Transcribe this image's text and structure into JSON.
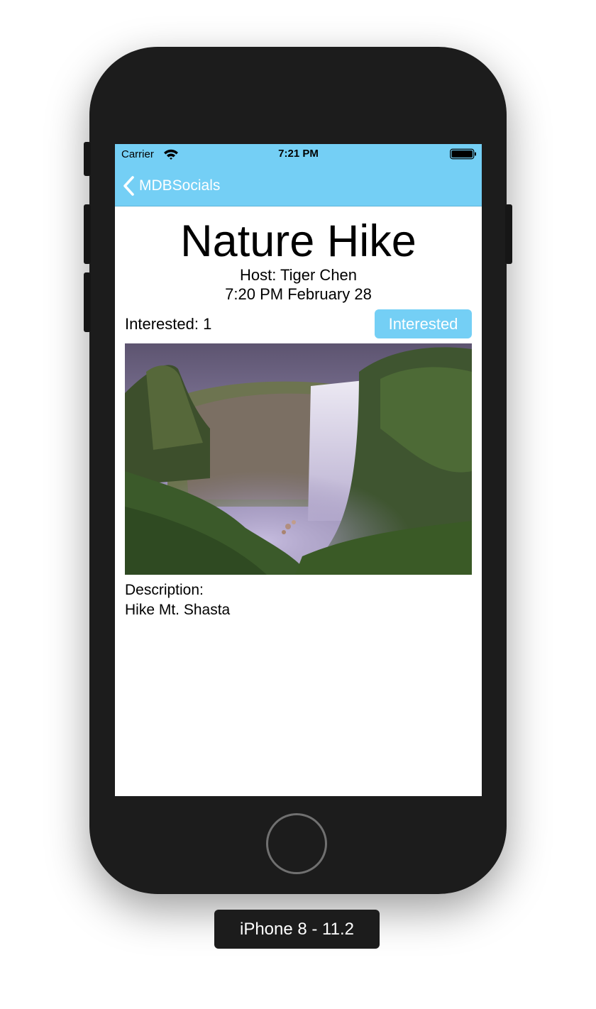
{
  "status_bar": {
    "carrier": "Carrier",
    "time": "7:21 PM",
    "wifi_icon": "wifi-icon",
    "battery_icon": "battery-icon"
  },
  "nav_bar": {
    "back_label": "MDBSocials",
    "back_icon": "chevron-left-icon",
    "color": "#74cff5"
  },
  "event": {
    "title": "Nature Hike",
    "host": "Host: Tiger Chen",
    "datetime": "7:20 PM February 28",
    "interested_count": "Interested: 1",
    "interested_button": "Interested",
    "description_label": "Description:",
    "description": "Hike Mt. Shasta"
  },
  "simulator": {
    "device_label": "iPhone 8 - 11.2"
  },
  "colors": {
    "accent": "#74cff5",
    "device_body": "#1c1c1c"
  }
}
